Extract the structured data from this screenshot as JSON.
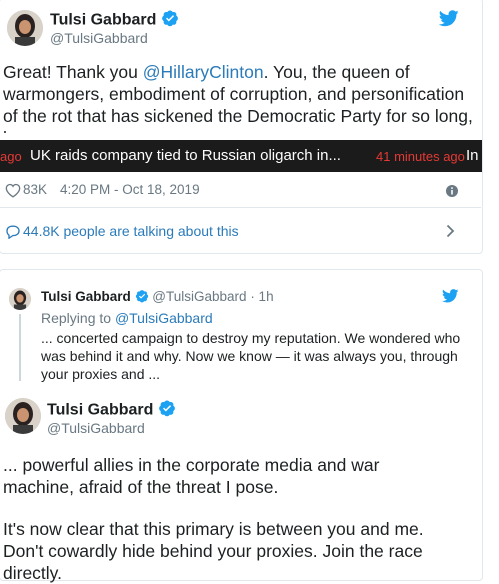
{
  "tweet": {
    "name": "Tulsi Gabbard",
    "handle": "@TulsiGabbard",
    "text_before": "Great! Thank you ",
    "mention": "@HillaryClinton",
    "text_after": ". You, the queen of warmongers, embodiment of corruption, and personification of the rot that has sickened the Democratic Party for so long, have",
    "likes": "83K",
    "timestamp": "4:20 PM - Oct 18, 2019",
    "talking": "44.8K people are talking about this"
  },
  "ticker": {
    "prev_suffix": "ago",
    "headline": "UK raids company tied to Russian oligarch in...",
    "time": "41 minutes ago",
    "next_prefix": "In"
  },
  "reply": {
    "name": "Tulsi Gabbard",
    "handle": "@TulsiGabbard",
    "age": "· 1h",
    "replying_prefix": "Replying to ",
    "replying_handle": "@TulsiGabbard",
    "text": "... concerted campaign to destroy my reputation. We wondered who was behind it and why. Now we know — it was always you, through your proxies and ..."
  },
  "thread": {
    "name": "Tulsi Gabbard",
    "handle": "@TulsiGabbard",
    "para1": "... powerful allies in the corporate media and war machine, afraid of the threat I pose.",
    "para2": "It's now clear that this primary is between you and me. Don't cowardly hide behind your proxies. Join the race directly."
  },
  "colors": {
    "twitter_blue": "#1da1f2",
    "link_blue": "#2b7bb9",
    "ticker_red": "#e53935"
  }
}
